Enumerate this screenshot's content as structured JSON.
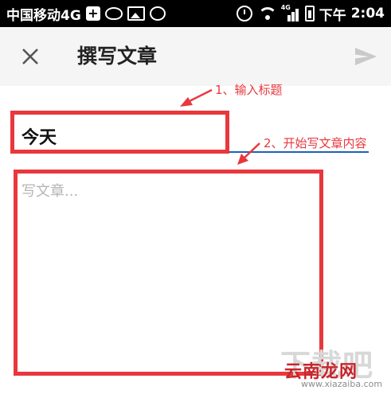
{
  "status_bar": {
    "carrier": "中国移动4G",
    "signal_label": "4G",
    "time_period": "下午",
    "time": "2:04",
    "icons": [
      "plus-icon",
      "weibo-icon",
      "gallery-icon",
      "chat-icon",
      "alarm-icon",
      "wifi-icon",
      "signal-icon",
      "battery-icon"
    ]
  },
  "app_bar": {
    "title": "撰写文章",
    "close_icon": "close-icon",
    "send_icon": "send-icon"
  },
  "form": {
    "title_value": "今天",
    "content_placeholder": "写文章...",
    "accent_color": "#1a63b8"
  },
  "annotations": {
    "step1": "1、输入标题",
    "step2": "2、开始写文章内容",
    "color": "#e8383d"
  },
  "watermark": {
    "large_text": "下载吧",
    "logo": "云南龙网",
    "url": "www.xiazaiba.com"
  }
}
